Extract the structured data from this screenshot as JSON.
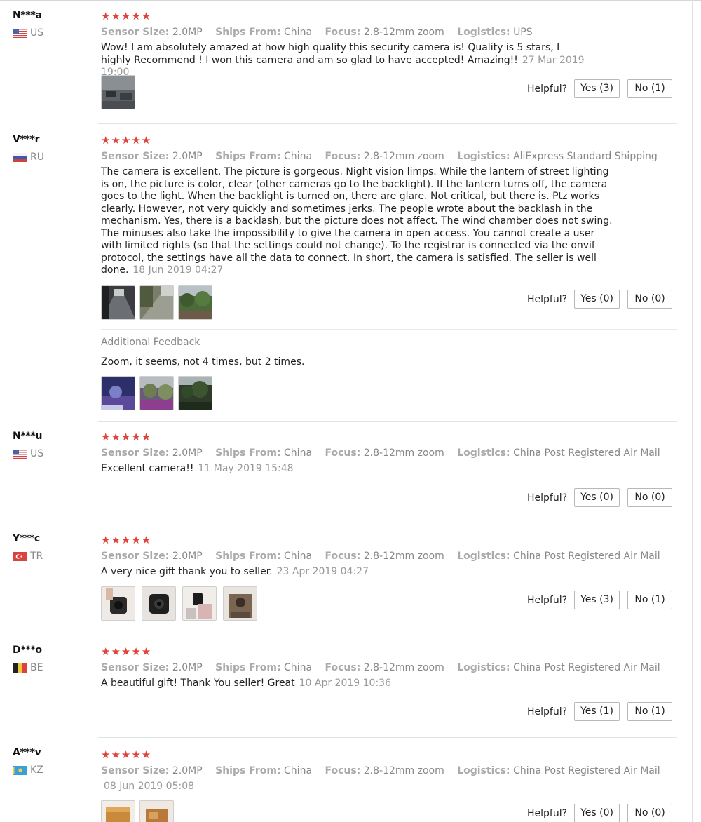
{
  "helpful_label": "Helpful?",
  "stars": "★★★★★",
  "attr_labels": {
    "sensor": "Sensor Size:",
    "ships": "Ships From:",
    "focus": "Focus:",
    "logistics": "Logistics:"
  },
  "reviews": [
    {
      "user": "N***a",
      "country": "US",
      "sensor": "2.0MP",
      "ships": "China",
      "focus": "2.8-12mm zoom",
      "logistics": "UPS",
      "text": "Wow! I am absolutely amazed at how high quality this security camera is! Quality is 5 stars, I highly Recommend ! I won this camera and am so glad to have accepted! Amazing!!",
      "date": "27 Mar 2019 19:00",
      "yes": "Yes (3)",
      "no": "No (1)"
    },
    {
      "user": "V***r",
      "country": "RU",
      "sensor": "2.0MP",
      "ships": "China",
      "focus": "2.8-12mm zoom",
      "logistics": "AliExpress Standard Shipping",
      "text": "The camera is excellent. The picture is gorgeous. Night vision limps. While the lantern of street lighting is on, the picture is color, clear (other cameras go to the backlight). If the lantern turns off, the camera goes to the light. When the backlight is turned on, there are glare. Not critical, but there is. Ptz works clearly. However, not very quickly and sometimes jerks. The people wrote about the backlash in the mechanism. Yes, there is a backlash, but the picture does not affect. The wind chamber does not swing. The minuses also take the impossibility to give the camera in open access. You cannot create a user with limited rights (so that the settings could not change). To the registrar is connected via the onvif protocol, the settings have all the data to connect. In short, the camera is satisfied. The seller is well done.",
      "date": "18 Jun 2019 04:27",
      "yes": "Yes (0)",
      "no": "No (0)",
      "additional_title": "Additional Feedback",
      "additional_text": "Zoom, it seems, not 4 times, but 2 times."
    },
    {
      "user": "N***u",
      "country": "US",
      "sensor": "2.0MP",
      "ships": "China",
      "focus": "2.8-12mm zoom",
      "logistics": "China Post Registered Air Mail",
      "text": "Excellent camera!!",
      "date": "11 May 2019 15:48",
      "yes": "Yes (0)",
      "no": "No (0)"
    },
    {
      "user": "Y***c",
      "country": "TR",
      "sensor": "2.0MP",
      "ships": "China",
      "focus": "2.8-12mm zoom",
      "logistics": "China Post Registered Air Mail",
      "text": "A very nice gift thank you to seller.",
      "date": "23 Apr 2019 04:27",
      "yes": "Yes (3)",
      "no": "No (1)"
    },
    {
      "user": "D***o",
      "country": "BE",
      "sensor": "2.0MP",
      "ships": "China",
      "focus": "2.8-12mm zoom",
      "logistics": "China Post Registered Air Mail",
      "text": "A beautiful gift! Thank You seller! Great",
      "date": "10 Apr 2019 10:36",
      "yes": "Yes (1)",
      "no": "No (1)"
    },
    {
      "user": "A***v",
      "country": "KZ",
      "sensor": "2.0MP",
      "ships": "China",
      "focus": "2.8-12mm zoom",
      "logistics": "China Post Registered Air Mail",
      "text": "",
      "date": "08 Jun 2019 05:08",
      "yes": "Yes (0)",
      "no": "No (0)"
    }
  ],
  "colors": {
    "stars": "#e0433a",
    "muted_text": "#888888",
    "attr_label": "#aaaaaa",
    "separator": "#e3e3e3"
  }
}
